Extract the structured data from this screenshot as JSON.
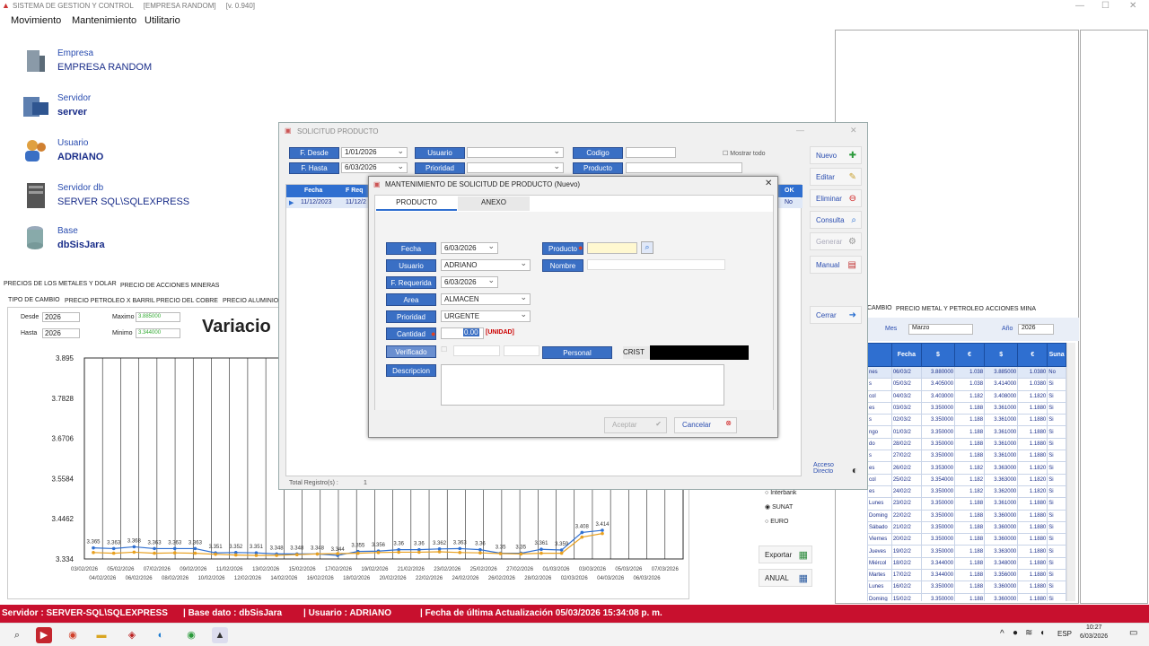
{
  "app": {
    "title": "SISTEMA DE GESTION Y CONTROL",
    "company_tag": "[EMPRESA RANDOM]",
    "version": "[v. 0.940]"
  },
  "menu": [
    "Movimiento",
    "Mantenimiento",
    "Utilitario"
  ],
  "info": [
    {
      "label": "Empresa",
      "value": "EMPRESA RANDOM",
      "icon": "building-icon"
    },
    {
      "label": "Servidor",
      "value": "server",
      "icon": "server-icon"
    },
    {
      "label": "Usuario",
      "value": "ADRIANO",
      "icon": "users-icon"
    },
    {
      "label": "Servidor db",
      "value": "SERVER SQL\\SQLEXPRESS",
      "icon": "db-server-icon"
    },
    {
      "label": "Base",
      "value": "dbSisJara",
      "icon": "database-icon"
    }
  ],
  "tabs_top": [
    "PRECIOS DE LOS METALES Y DOLAR",
    "PRECIO DE ACCIONES MINERAS"
  ],
  "tabs_sub": [
    "TIPO DE CAMBIO",
    "PRECIO PETROLEO X BARRIL",
    "PRECIO DEL COBRE",
    "PRECIO ALUMINIO"
  ],
  "chart_panel": {
    "desde_label": "Desde",
    "desde": "2026",
    "hasta_label": "Hasta",
    "hasta": "2026",
    "maximo_label": "Maximo",
    "maximo": "3.885000",
    "minimo_label": "Minimo",
    "minimo": "3.344000",
    "title": "Variacio"
  },
  "chart_data": {
    "type": "line",
    "title": "Variacio",
    "yticks": [
      "3.895",
      "3.7828",
      "3.6706",
      "3.5584",
      "3.4462",
      "3.334"
    ],
    "ylim": [
      3.334,
      3.895
    ],
    "xticks_top": [
      "03/02/2026",
      "05/02/2026",
      "07/02/2026",
      "09/02/2026",
      "11/02/2026",
      "13/02/2026",
      "15/02/2026",
      "17/02/2026",
      "19/02/2026",
      "21/02/2026",
      "23/02/2026",
      "25/02/2026",
      "27/02/2026",
      "01/03/2026",
      "03/03/2026",
      "05/03/2026",
      "07/03/2026"
    ],
    "xticks_bottom": [
      "04/02/2026",
      "06/02/2026",
      "08/02/2026",
      "10/02/2026",
      "12/02/2026",
      "14/02/2026",
      "16/02/2026",
      "18/02/2026",
      "20/02/2026",
      "22/02/2026",
      "24/02/2026",
      "26/02/2026",
      "28/02/2026",
      "02/03/2026",
      "04/03/2026",
      "06/03/2026"
    ],
    "series": [
      {
        "values": [
          3.365,
          3.363,
          3.368,
          3.363,
          3.363,
          3.363,
          3.351,
          3.352,
          3.351,
          3.348,
          3.348,
          3.348,
          3.344,
          3.355,
          3.356,
          3.36,
          3.36,
          3.362,
          3.363,
          3.36,
          3.35,
          3.35,
          3.361,
          3.359,
          3.408,
          3.414
        ]
      },
      {
        "values": [
          3.352,
          3.35,
          3.353,
          3.35,
          3.351,
          3.35,
          3.347,
          3.345,
          3.344,
          3.344,
          3.346,
          3.348,
          3.349,
          3.35,
          3.352,
          3.353,
          3.353,
          3.354,
          3.352,
          3.351,
          3.349,
          3.348,
          3.35,
          3.35,
          3.395,
          3.405
        ]
      }
    ],
    "labels_line1": [
      "3.365",
      "3.363",
      "3.368",
      "3.363",
      "3.363",
      "3.363",
      "3.351",
      "3.352",
      "3.351",
      "3.348",
      "3.348",
      "3.348",
      "3.344",
      "3.355",
      "3.356",
      "3.36",
      "3.36",
      "3.362",
      "3.363",
      "3.36",
      "3.35",
      "3.35",
      "3.361",
      "3.359",
      "3.408",
      "3.414"
    ]
  },
  "radio": {
    "interbank": "Interbank",
    "sunat": "SUNAT",
    "euro": "EURO"
  },
  "export_btn": "Exportar",
  "anual_btn": "ANUAL",
  "right_tabs": [
    "CAMBIO",
    "PRECIO METAL Y PETROLEO",
    "ACCIONES MINA"
  ],
  "right_filter": {
    "mes_label": "Mes",
    "mes": "Marzo",
    "anio_label": "Año",
    "anio": "2026"
  },
  "right_grid": {
    "headers": [
      "",
      "Fecha",
      "$",
      "€",
      "$",
      "€",
      "Suna"
    ],
    "rows": [
      [
        "nes",
        "06/03/2",
        "3.880000",
        "1.038",
        "3.885000",
        "1.0380",
        "No"
      ],
      [
        "s",
        "05/03/2",
        "3.405000",
        "1.038",
        "3.414000",
        "1.0380",
        "Si"
      ],
      [
        "col",
        "04/03/2",
        "3.403000",
        "1.182",
        "3.408000",
        "1.1820",
        "Si"
      ],
      [
        "es",
        "03/03/2",
        "3.350000",
        "1.188",
        "3.361000",
        "1.1880",
        "Si"
      ],
      [
        "s",
        "02/03/2",
        "3.350000",
        "1.188",
        "3.361000",
        "1.1880",
        "Si"
      ],
      [
        "ngo",
        "01/03/2",
        "3.350000",
        "1.188",
        "3.361000",
        "1.1880",
        "Si"
      ],
      [
        "do",
        "28/02/2",
        "3.350000",
        "1.188",
        "3.361000",
        "1.1880",
        "Si"
      ],
      [
        "s",
        "27/02/2",
        "3.350000",
        "1.188",
        "3.361000",
        "1.1880",
        "Si"
      ],
      [
        "es",
        "26/02/2",
        "3.353000",
        "1.182",
        "3.363000",
        "1.1820",
        "Si"
      ],
      [
        "col",
        "25/02/2",
        "3.354000",
        "1.182",
        "3.363000",
        "1.1820",
        "Si"
      ],
      [
        "es",
        "24/02/2",
        "3.350000",
        "1.182",
        "3.362000",
        "1.1820",
        "Si"
      ],
      [
        "Lunes",
        "23/02/2",
        "3.350000",
        "1.188",
        "3.361000",
        "1.1880",
        "Si"
      ],
      [
        "Doming",
        "22/02/2",
        "3.350000",
        "1.188",
        "3.360000",
        "1.1880",
        "Si"
      ],
      [
        "Sábado",
        "21/02/2",
        "3.350000",
        "1.188",
        "3.360000",
        "1.1880",
        "Si"
      ],
      [
        "Viernes",
        "20/02/2",
        "3.350000",
        "1.188",
        "3.360000",
        "1.1880",
        "Si"
      ],
      [
        "Jueves",
        "19/02/2",
        "3.350000",
        "1.188",
        "3.363000",
        "1.1880",
        "Si"
      ],
      [
        "Miércol",
        "18/02/2",
        "3.344000",
        "1.188",
        "3.348000",
        "1.1880",
        "Si"
      ],
      [
        "Martes",
        "17/02/2",
        "3.344000",
        "1.188",
        "3.356000",
        "1.1880",
        "Si"
      ],
      [
        "Lunes",
        "16/02/2",
        "3.350000",
        "1.188",
        "3.360000",
        "1.1880",
        "Si"
      ],
      [
        "Doming",
        "15/02/2",
        "3.350000",
        "1.188",
        "3.360000",
        "1.1880",
        "Si"
      ]
    ]
  },
  "solicitud": {
    "title": "SOLICITUD PRODUCTO",
    "f_desde": "F. Desde",
    "f_desde_val": "1/01/2026",
    "f_hasta": "F. Hasta",
    "f_hasta_val": "6/03/2026",
    "usuario": "Usuario",
    "prioridad": "Prioridad",
    "codigo": "Codigo",
    "producto": "Producto",
    "mostrar_todo": "Mostrar todo",
    "col_fecha": "Fecha",
    "col_freq": "F Req",
    "row_fecha": "11/12/2023",
    "row_freq": "11/12/2",
    "ok_col": "OK",
    "ok_val": "No",
    "total_label": "Total Registro(s) :",
    "total": "1",
    "buttons": [
      {
        "label": "Nuevo",
        "icon": "plus-icon"
      },
      {
        "label": "Editar",
        "icon": "pencil-icon"
      },
      {
        "label": "Eliminar",
        "icon": "delete-icon"
      },
      {
        "label": "Consulta",
        "icon": "search-icon"
      },
      {
        "label": "Generar",
        "icon": "gear-icon"
      },
      {
        "label": "Manual",
        "icon": "book-icon"
      },
      {
        "label": "Cerrar",
        "icon": "arrow-right-icon"
      }
    ],
    "acceso": "Acceso",
    "directo": "Directo"
  },
  "mantenimiento": {
    "title": "MANTENIMIENTO DE SOLICITUD DE PRODUCTO (Nuevo)",
    "tab1": "PRODUCTO",
    "tab2": "ANEXO",
    "fecha_label": "Fecha",
    "fecha": "6/03/2026",
    "usuario_label": "Usuario",
    "usuario": "ADRIANO",
    "freq_label": "F. Requerida",
    "freq": "6/03/2026",
    "area_label": "Area",
    "area": "ALMACEN",
    "prioridad_label": "Prioridad",
    "prioridad": "URGENTE",
    "cantidad_label": "Cantidad",
    "cantidad": "0.00",
    "unidad": "[UNIDAD]",
    "verificado_label": "Verificado",
    "descripcion_label": "Descripcion",
    "producto_label": "Producto",
    "nombre_label": "Nombre",
    "personal_label": "Personal",
    "personal": "CRIST",
    "aceptar": "Aceptar",
    "cancelar": "Cancelar"
  },
  "status": {
    "servidor": "Servidor : SERVER-SQL\\SQLEXPRESS",
    "base": "| Base dato : dbSisJara",
    "usuario": "| Usuario : ADRIANO",
    "fecha": "| Fecha de última Actualización 05/03/2026 15:34:08 p. m."
  },
  "taskbar": {
    "lang": "ESP",
    "time": "10:27",
    "date": "6/03/2026"
  }
}
